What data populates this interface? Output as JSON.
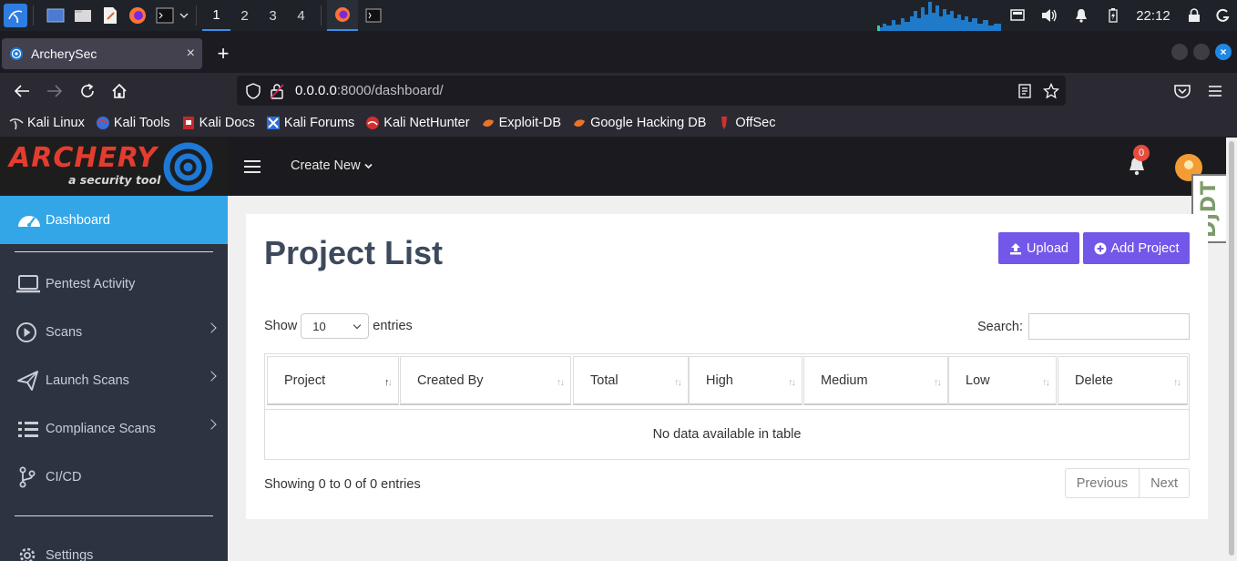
{
  "taskbar": {
    "workspaces": [
      "1",
      "2",
      "3",
      "4"
    ],
    "clock": "22:12"
  },
  "browser": {
    "tab_title": "ArcherySec",
    "new_tab_symbol": "+",
    "url_host": "0.0.0.0",
    "url_rest": ":8000/dashboard/",
    "bookmarks": [
      "Kali Linux",
      "Kali Tools",
      "Kali Docs",
      "Kali Forums",
      "Kali NetHunter",
      "Exploit-DB",
      "Google Hacking DB",
      "OffSec"
    ]
  },
  "app": {
    "logo_text": "ARCHERY",
    "logo_subtitle": "a security tool",
    "create_new": "Create New",
    "notification_count": "0",
    "debug_toolbar": "DjDT",
    "sidebar": {
      "items": [
        {
          "label": "Dashboard",
          "icon": "speedometer-icon"
        },
        {
          "label": "Pentest Activity",
          "icon": "laptop-icon"
        },
        {
          "label": "Scans",
          "icon": "play-circle-icon"
        },
        {
          "label": "Launch Scans",
          "icon": "paper-plane-icon"
        },
        {
          "label": "Compliance Scans",
          "icon": "list-icon"
        },
        {
          "label": "CI/CD",
          "icon": "git-branch-icon"
        },
        {
          "label": "Settings",
          "icon": "gear-icon"
        }
      ]
    }
  },
  "main": {
    "title": "Project List",
    "upload_label": "Upload",
    "add_project_label": "Add Project",
    "show_label": "Show",
    "entries_value": "10",
    "entries_label": "entries",
    "search_label": "Search:",
    "columns": [
      "Project",
      "Created By",
      "Total",
      "High",
      "Medium",
      "Low",
      "Delete"
    ],
    "empty_message": "No data available in table",
    "info": "Showing 0 to 0 of 0 entries",
    "previous_label": "Previous",
    "next_label": "Next"
  },
  "colors": {
    "accent": "#7357e8",
    "sidebar_active": "#33a6e8",
    "sidebar_bg": "#2d3441",
    "logo_red": "#e43c2f",
    "logo_blue": "#1e78d6"
  }
}
